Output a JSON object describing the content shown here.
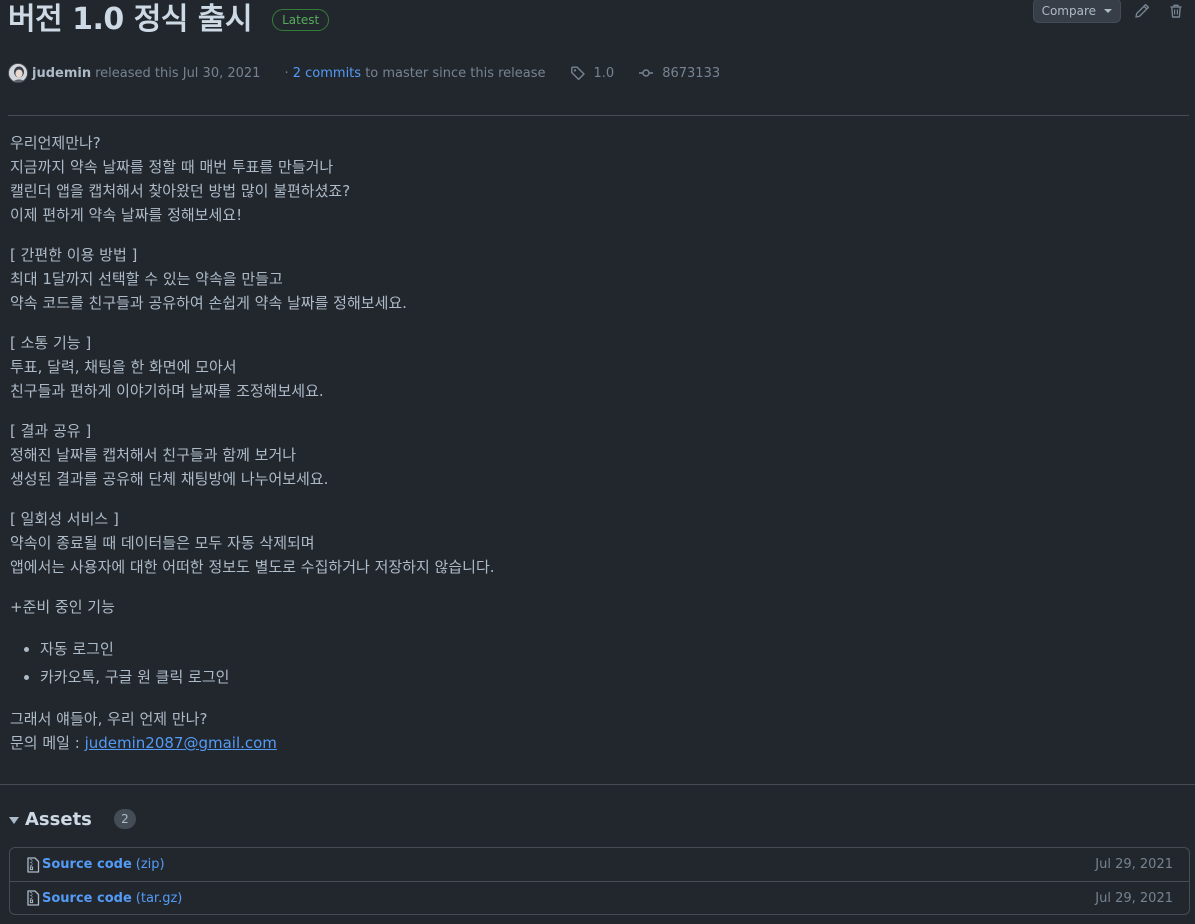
{
  "release": {
    "title": "버전 1.0 정식 출시",
    "badge": "Latest"
  },
  "actions": {
    "compare_label": "Compare"
  },
  "meta": {
    "author": "judemin",
    "released_text": "released this Jul 30, 2021",
    "commits_prefix": "·",
    "commits_count": "2 commits",
    "commits_suffix": "to master since this release",
    "tag": "1.0",
    "sha": "8673133"
  },
  "body": {
    "intro": [
      "우리언제만나?",
      "지금까지 약속 날짜를 정할 때 매번 투표를 만들거나",
      "캘린더 앱을 캡처해서 찾아왔던 방법 많이 불편하셨죠?",
      "이제 편하게 약속 날짜를 정해보세요!"
    ],
    "usage": [
      "[ 간편한 이용 방법 ]",
      "최대 1달까지 선택할 수 있는 약속을 만들고",
      "약속 코드를 친구들과 공유하여 손쉽게 약속 날짜를 정해보세요."
    ],
    "communication": [
      "[ 소통 기능 ]",
      "투표, 달력, 채팅을 한 화면에 모아서",
      "친구들과 편하게 이야기하며 날짜를 조정해보세요."
    ],
    "share": [
      "[ 결과 공유 ]",
      "정해진 날짜를 캡처해서 친구들과 함께 보거나",
      "생성된 결과를 공유해 단체 채팅방에 나누어보세요."
    ],
    "onetime": [
      "[ 일회성 서비스 ]",
      "약속이 종료될 때 데이터들은 모두 자동 삭제되며",
      "앱에서는 사용자에 대한 어떠한 정보도 별도로 수집하거나 저장하지 않습니다."
    ],
    "upcoming_title": "+준비 중인 기능",
    "upcoming_items": [
      "자동 로그인",
      "카카오톡, 구글 원 클릭 로그인"
    ],
    "closing": "그래서 얘들아, 우리 언제 만나?",
    "contact_label": "문의 메일 : ",
    "contact_email": "judemin2087@gmail.com"
  },
  "assets": {
    "title": "Assets",
    "count": "2",
    "items": [
      {
        "name": "Source code",
        "ext": "(zip)",
        "date": "Jul 29, 2021"
      },
      {
        "name": "Source code",
        "ext": "(tar.gz)",
        "date": "Jul 29, 2021"
      }
    ]
  },
  "colors": {
    "background": "#22272e",
    "text": "#adbac7",
    "link": "#539bf5",
    "latest_green": "#57ab5a",
    "border": "#444c56"
  }
}
